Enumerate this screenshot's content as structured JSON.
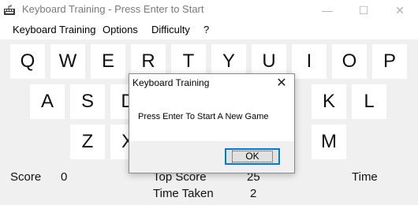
{
  "window": {
    "title": "Keyboard Training - Press Enter to Start",
    "minimize": "—",
    "maximize": "☐",
    "close": "✕"
  },
  "menu": {
    "items": [
      "Keyboard Training",
      "Options",
      "Difficulty",
      "?"
    ]
  },
  "keys": {
    "row1": [
      "Q",
      "W",
      "E",
      "R",
      "T",
      "Y",
      "U",
      "I",
      "O",
      "P"
    ],
    "row2": [
      "A",
      "S",
      "D",
      "",
      "",
      "",
      "",
      "K",
      "L"
    ],
    "row3": [
      "Z",
      "X",
      "",
      "",
      "",
      "",
      "M"
    ]
  },
  "status": {
    "score_label": "Score",
    "score_value": "0",
    "top_score_label": "Top Score",
    "top_score_value": "25",
    "time_label": "Time",
    "time_taken_label": "Time Taken",
    "time_taken_value": "2"
  },
  "dialog": {
    "title": "Keyboard Training",
    "close": "✕",
    "message": "Press Enter To Start A New Game",
    "ok_label": "OK"
  },
  "colors": {
    "focus_accent": "#0078d7"
  }
}
